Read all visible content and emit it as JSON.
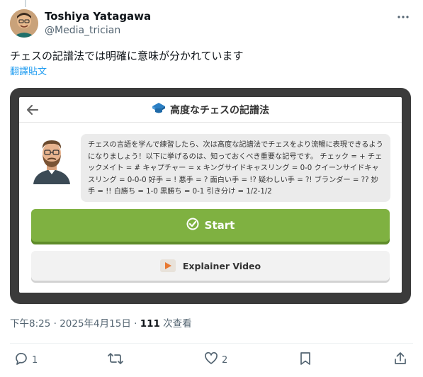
{
  "author": {
    "name": "Toshiya Yatagawa",
    "handle": "@Media_trician"
  },
  "tweet": {
    "text": "チェスの記譜法では明確に意味が分かれています",
    "translate_label": "翻譯貼文"
  },
  "embed": {
    "title": "高度なチェスの記譜法",
    "bubble_text": "チェスの言語を学んで練習したら、次は高度な記譜法でチェスをより流暢に表現できるようになりましょう！以下に挙げるのは、知っておくべき重要な記号です。 チェック = + チェックメイト = # キャプチャー = x キングサイドキャスリング = 0-0 クイーンサイドキャスリング = 0-0-0 好手 = ! 悪手 = ? 面白い手 = !? 疑わしい手 = ?! ブランダー = ?? 妙手 = !! 白勝ち = 1-0 黒勝ち = 0-1 引き分け = 1/2-1/2",
    "start_label": "Start",
    "video_label": "Explainer Video",
    "colors": {
      "start": "#7fb141",
      "card_bg": "#3b3b3b"
    }
  },
  "meta": {
    "time": "下午8:25 · 2025年4月15日 · ",
    "views": "111",
    "views_label": " 次查看"
  },
  "actions": {
    "replies": "1",
    "likes": "2"
  },
  "icons": [
    "more-icon",
    "back-arrow-icon",
    "mortarboard-icon",
    "check-circle-icon",
    "play-icon",
    "reply-icon",
    "retweet-icon",
    "like-icon",
    "bookmark-icon",
    "share-icon"
  ]
}
